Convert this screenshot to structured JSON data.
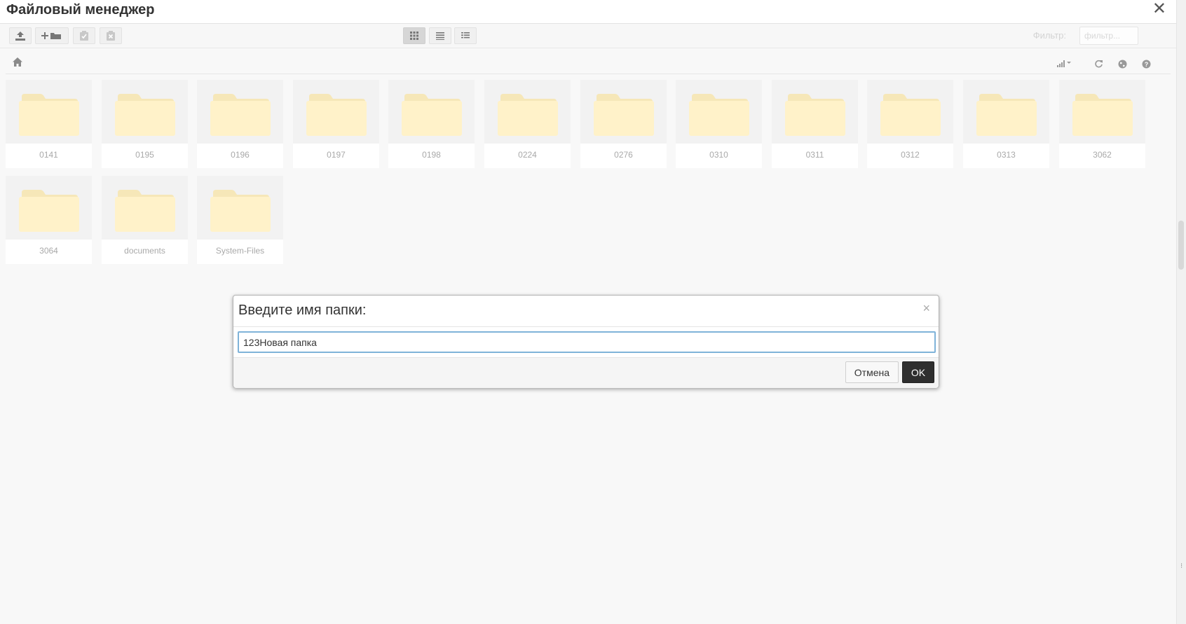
{
  "window": {
    "title": "Файловый менеджер",
    "close_label": "✕"
  },
  "toolbar": {
    "filter_label": "Фильтр:",
    "filter_placeholder": "фильтр...",
    "filter_value": ""
  },
  "folders": [
    {
      "name": "0141"
    },
    {
      "name": "0195"
    },
    {
      "name": "0196"
    },
    {
      "name": "0197"
    },
    {
      "name": "0198"
    },
    {
      "name": "0224"
    },
    {
      "name": "0276"
    },
    {
      "name": "0310"
    },
    {
      "name": "0311"
    },
    {
      "name": "0312"
    },
    {
      "name": "0313"
    },
    {
      "name": "3062"
    },
    {
      "name": "3064"
    },
    {
      "name": "documents"
    },
    {
      "name": "System-Files"
    }
  ],
  "dialog": {
    "title": "Введите имя папки:",
    "close_label": "×",
    "input_value": "123Новая папка",
    "cancel_label": "Отмена",
    "ok_label": "OK"
  },
  "colors": {
    "folder": "#fff2c9",
    "folder_tab": "#f6e7b8",
    "ok_button": "#2f2f2f",
    "input_focus_border": "#7fb3d9"
  }
}
